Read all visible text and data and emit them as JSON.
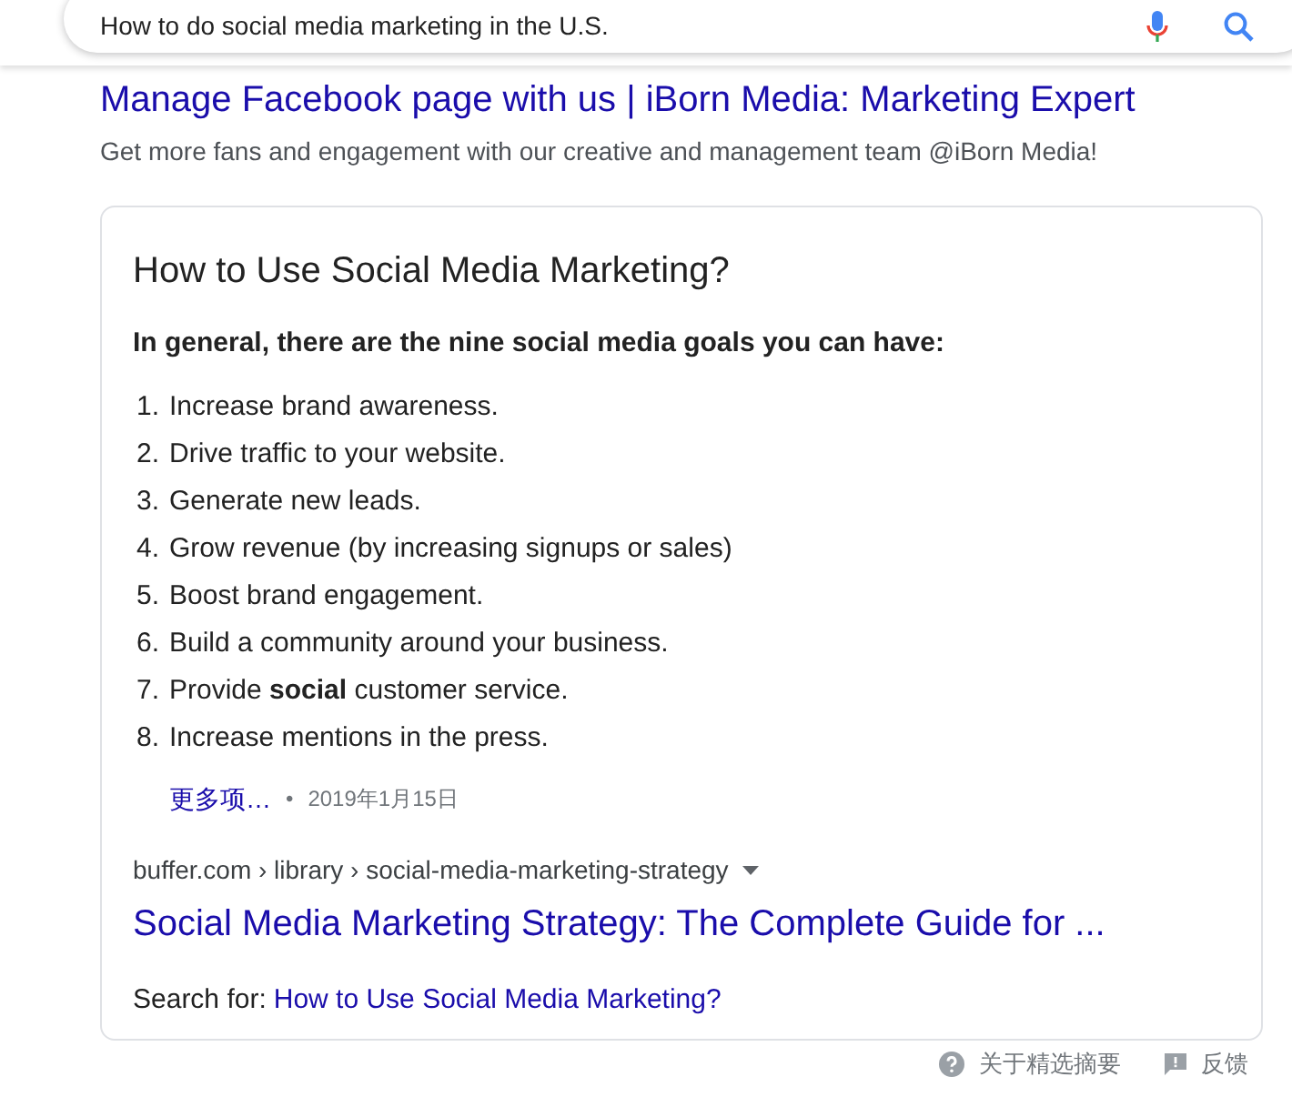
{
  "search": {
    "value": "How to do social media marketing in the U.S."
  },
  "ad": {
    "title": "Manage Facebook page with us | iBorn Media: Marketing Expert",
    "description": "Get more fans and engagement with our creative and management team @iBorn Media!"
  },
  "snippet": {
    "heading": "How to Use Social Media Marketing?",
    "intro": "In general, there are the nine social media goals you can have:",
    "items": [
      {
        "marker": "1.",
        "text": "Increase brand awareness."
      },
      {
        "marker": "2.",
        "text": "Drive traffic to your website."
      },
      {
        "marker": "3.",
        "text": "Generate new leads."
      },
      {
        "marker": "4.",
        "text": "Grow revenue (by increasing signups or sales)"
      },
      {
        "marker": "5.",
        "text": "Boost brand engagement."
      },
      {
        "marker": "6.",
        "text": "Build a community around your business."
      },
      {
        "marker": "7.",
        "text": "Provide **social** customer service."
      },
      {
        "marker": "8.",
        "text": "Increase mentions in the press."
      }
    ],
    "more_link": "更多项…",
    "separator": "•",
    "date": "2019年1月15日",
    "breadcrumb": "buffer.com › library › social-media-marketing-strategy",
    "result_title": "Social Media Marketing Strategy: The Complete Guide for ...",
    "search_for_label": "Search for:",
    "search_for_link": "How to Use Social Media Marketing?"
  },
  "footer": {
    "about": "关于精选摘要",
    "feedback": "反馈"
  }
}
